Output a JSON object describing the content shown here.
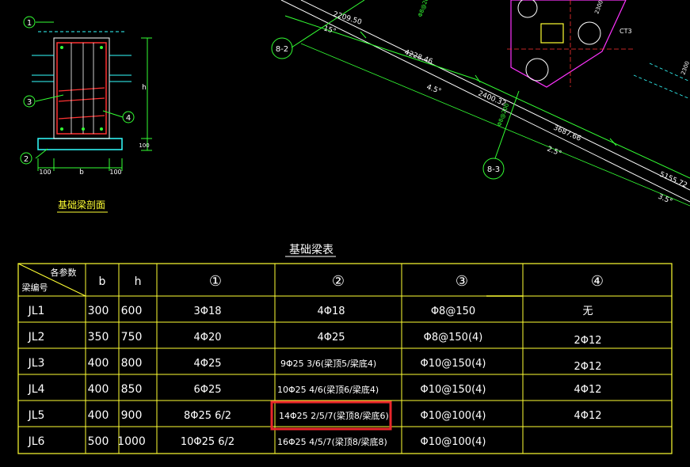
{
  "section_drawing": {
    "title": "基础梁剖面",
    "markers": [
      "1",
      "2",
      "3",
      "4"
    ],
    "dims": {
      "left": "100",
      "center": "b",
      "right": "100",
      "height": "h",
      "bottom": "100"
    }
  },
  "plan_drawing": {
    "axis_labels": [
      "8-2",
      "8-3"
    ],
    "lengths": [
      "2209.50",
      "4228.46",
      "2400.32",
      "3687.66",
      "5155.72"
    ],
    "angles": [
      "15°",
      "4.5°",
      "2.5°",
      "3.5°"
    ],
    "pile_label": "CT3",
    "rebar_notes": [
      "Φ8@200",
      "Φ8@200",
      "2300",
      "2300"
    ]
  },
  "beam_table": {
    "title": "基础梁表",
    "corner_top": "各参数",
    "corner_bottom": "梁编号",
    "headers": [
      "b",
      "h",
      "①",
      "②",
      "③",
      "④"
    ],
    "rows": [
      {
        "id": "JL1",
        "b": "300",
        "h": "600",
        "c1": "3Φ18",
        "c2": "4Φ18",
        "c3": "Φ8@150",
        "c4": "无"
      },
      {
        "id": "JL2",
        "b": "350",
        "h": "750",
        "c1": "4Φ20",
        "c2": "4Φ25",
        "c3": "Φ8@150(4)",
        "c4": "2Φ12"
      },
      {
        "id": "JL3",
        "b": "400",
        "h": "800",
        "c1": "4Φ25",
        "c2": "9Φ25 3/6(梁顶5/梁底4)",
        "c3": "Φ10@150(4)",
        "c4": "2Φ12"
      },
      {
        "id": "JL4",
        "b": "400",
        "h": "850",
        "c1": "6Φ25",
        "c2": "10Φ25 4/6(梁顶6/梁底4)",
        "c3": "Φ10@150(4)",
        "c4": "4Φ12"
      },
      {
        "id": "JL5",
        "b": "400",
        "h": "900",
        "c1": "8Φ25 6/2",
        "c2": "14Φ25 2/5/7(梁顶8/梁底6)",
        "c3": "Φ10@100(4)",
        "c4": "4Φ12"
      },
      {
        "id": "JL6",
        "b": "500",
        "h": "1000",
        "c1": "10Φ25 6/2",
        "c2": "16Φ25 4/5/7(梁顶8/梁底8)",
        "c3": "Φ10@100(4)",
        "c4": ""
      }
    ],
    "highlight_color": "#e8262b"
  },
  "colors": {
    "background": "#000000",
    "table_lines": "#ffff33",
    "text": "#ffffff",
    "green": "#33ff33",
    "red": "#ff3333",
    "magenta": "#ff33ff",
    "cyan": "#33ffff"
  }
}
